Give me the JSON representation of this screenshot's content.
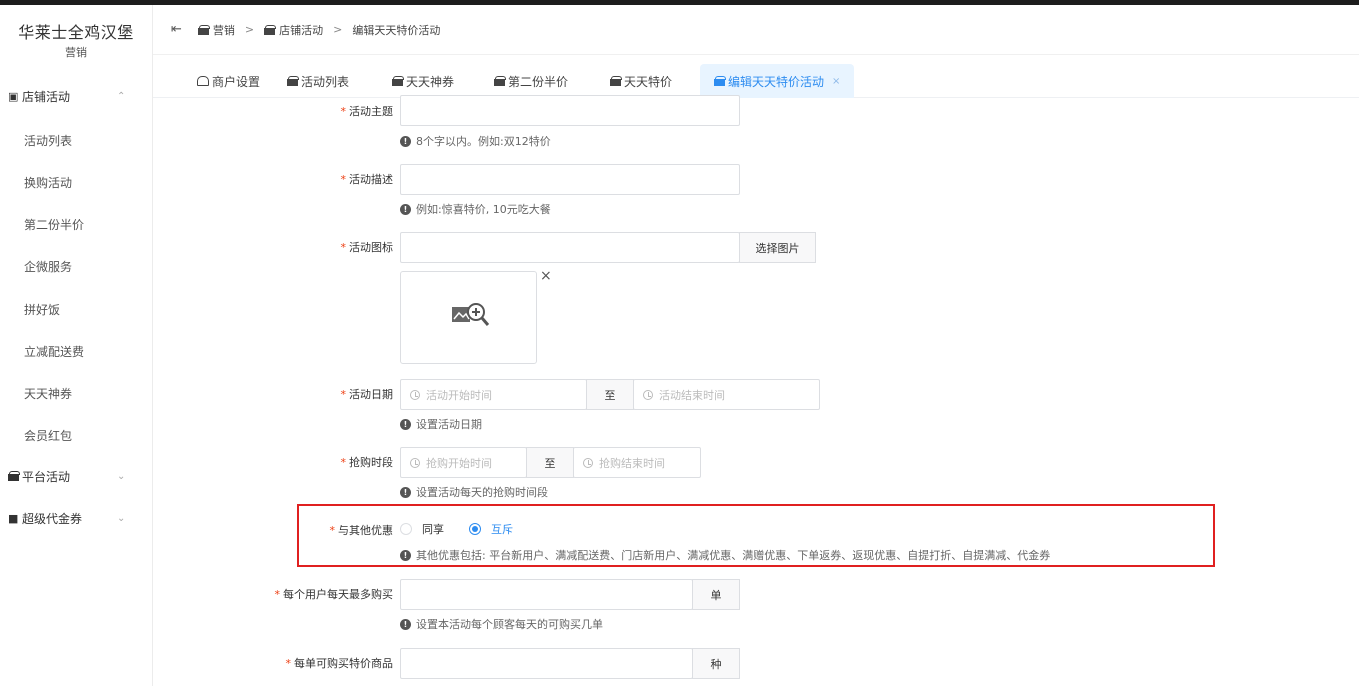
{
  "brand": {
    "title": "华莱士全鸡汉堡",
    "subtitle": "营销"
  },
  "sidebar": {
    "groups": [
      {
        "label": "店铺活动",
        "icon": "store-icon",
        "expanded": true
      },
      {
        "label": "平台活动",
        "icon": "gift-icon",
        "expanded": false
      },
      {
        "label": "超级代金券",
        "icon": "coupon-icon",
        "expanded": false
      }
    ],
    "items": [
      "活动列表",
      "换购活动",
      "第二份半价",
      "企微服务",
      "拼好饭",
      "立减配送费",
      "天天神券",
      "会员红包"
    ]
  },
  "header": {
    "breadcrumb": [
      "营销",
      "店铺活动",
      "编辑天天特价活动"
    ],
    "separator": ">"
  },
  "tabs": [
    {
      "label": "商户设置",
      "icon": "store-icon"
    },
    {
      "label": "活动列表",
      "icon": "gift-icon"
    },
    {
      "label": "天天神券",
      "icon": "gift-icon"
    },
    {
      "label": "第二份半价",
      "icon": "gift-icon"
    },
    {
      "label": "天天特价",
      "icon": "gift-icon"
    },
    {
      "label": "编辑天天特价活动",
      "icon": "gift-icon",
      "active": true,
      "close": "×"
    }
  ],
  "form": {
    "subject": {
      "label": "活动主题",
      "value": "",
      "hint": "8个字以内。例如:双12特价"
    },
    "description": {
      "label": "活动描述",
      "value": "",
      "hint": "例如:惊喜特价, 10元吃大餐"
    },
    "icon": {
      "label": "活动图标",
      "value": "",
      "button": "选择图片",
      "remove": "×"
    },
    "date": {
      "label": "活动日期",
      "start_placeholder": "活动开始时间",
      "to": "至",
      "end_placeholder": "活动结束时间",
      "hint": "设置活动日期"
    },
    "period": {
      "label": "抢购时段",
      "start_placeholder": "抢购开始时间",
      "to": "至",
      "end_placeholder": "抢购结束时间",
      "hint": "设置活动每天的抢购时间段"
    },
    "other_discount": {
      "label": "与其他优惠",
      "options": [
        "同享",
        "互斥"
      ],
      "selected": "互斥",
      "hint": "其他优惠包括: 平台新用户、满减配送费、门店新用户、满减优惠、满赠优惠、下单返券、返现优惠、自提打折、自提满减、代金券"
    },
    "daily_limit": {
      "label": "每个用户每天最多购买",
      "value": "",
      "unit": "单",
      "hint": "设置本活动每个顾客每天的可购买几单"
    },
    "per_order": {
      "label": "每单可购买特价商品",
      "value": "",
      "unit": "种"
    }
  },
  "colors": {
    "accent": "#2d8cf0",
    "highlight_box": "#e02020",
    "required": "#ed4014"
  }
}
